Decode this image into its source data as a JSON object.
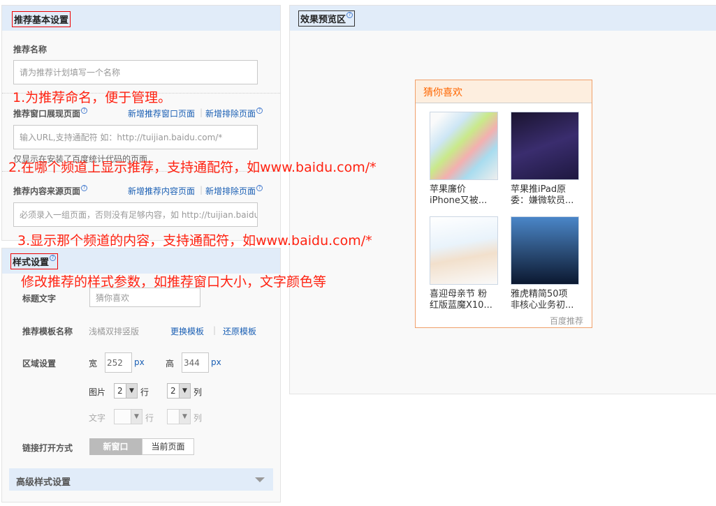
{
  "basic": {
    "title": "推荐基本设置",
    "name_label": "推荐名称",
    "name_placeholder": "请为推荐计划填写一个名称",
    "window_label": "推荐窗口展现页面",
    "window_add": "新增推荐窗口页面",
    "window_exclude": "新增排除页面",
    "window_placeholder": "输入URL,支持通配符  如：http://tuijian.baidu.com/*",
    "window_hint": "仅显示在安装了百度统计代码的页面",
    "source_label": "推荐内容来源页面",
    "source_add": "新增推荐内容页面",
    "source_exclude": "新增排除页面",
    "source_placeholder": "必须录入一组页面，否则没有足够内容，如 http://tuijian.baidu.com/*"
  },
  "style": {
    "title": "样式设置",
    "title_text_label": "标题文字",
    "title_text_value": "猜你喜欢",
    "template_label": "推荐模板名称",
    "template_value": "浅橘双排竖版",
    "change_template": "更换模板",
    "restore_template": "还原模板",
    "area_label": "区域设置",
    "width_label": "宽",
    "width_value": "252",
    "height_label": "高",
    "height_value": "344",
    "px": "px",
    "image_label": "图片",
    "image_rows": "2",
    "rows_unit": "行",
    "image_cols": "2",
    "cols_unit": "列",
    "text_label": "文字",
    "link_label": "链接打开方式",
    "new_window": "新窗口",
    "current_page": "当前页面",
    "advanced": "高级样式设置"
  },
  "preview": {
    "title": "效果预览区",
    "widget_title": "猜你喜欢",
    "items": [
      {
        "line1": "苹果廉价",
        "line2": "iPhone又被..."
      },
      {
        "line1": "苹果推iPad原",
        "line2": "委：嫌微软员..."
      },
      {
        "line1": "喜迎母亲节 粉",
        "line2": "红版蓝魔X10..."
      },
      {
        "line1": "雅虎精简50项",
        "line2": "非核心业务初..."
      }
    ],
    "footer": "百度推荐"
  },
  "annotations": [
    "1.为推荐命名，便于管理。",
    "2.在哪个频道上显示推荐，支持通配符，如www.baidu.com/*",
    "3.显示那个频道的内容，支持通配符，如www.baidu.com/*",
    "修改推荐的样式参数，如推荐窗口大小，文字颜色等"
  ],
  "colors": {
    "header_bg": "#e1ecf9",
    "link": "#1a5fb4",
    "annotation": "#ff2211",
    "widget_border": "#f0a06a",
    "widget_title": "#ff6600"
  }
}
